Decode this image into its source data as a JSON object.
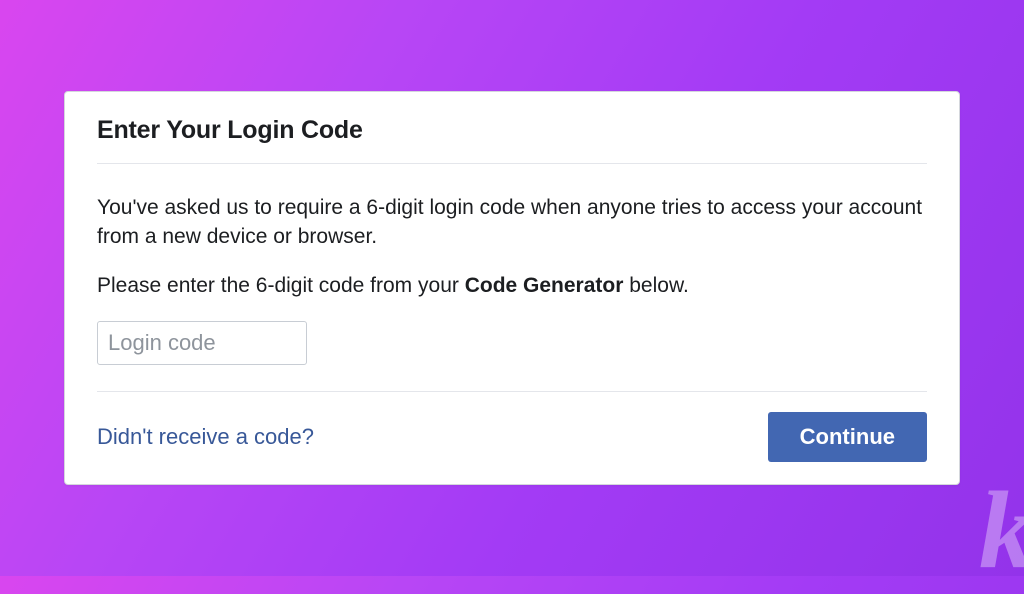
{
  "dialog": {
    "title": "Enter Your Login Code",
    "paragraph1": "You've asked us to require a 6-digit login code when anyone tries to access your account from a new device or browser.",
    "paragraph2_prefix": "Please enter the 6-digit code from your ",
    "paragraph2_bold": "Code Generator",
    "paragraph2_suffix": " below.",
    "input": {
      "placeholder": "Login code",
      "value": ""
    },
    "link_text": "Didn't receive a code?",
    "continue_label": "Continue"
  },
  "watermark": "k"
}
